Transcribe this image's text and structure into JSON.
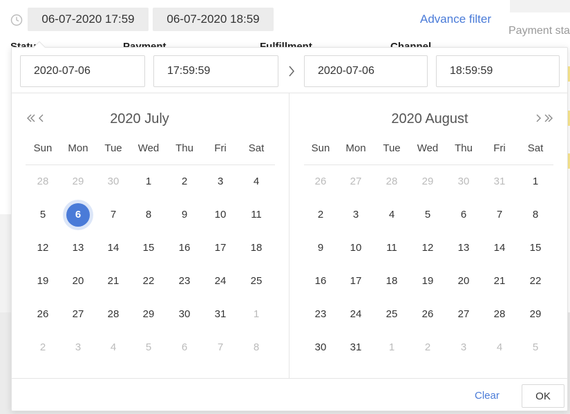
{
  "filter_bar": {
    "icon": "clock-icon",
    "start_chip": "06-07-2020 17:59",
    "end_chip": "06-07-2020 18:59",
    "advance_filter": "Advance filter",
    "payment_status_partial": "Payment sta",
    "labels": [
      "Status",
      "Payment",
      "Fulfillment",
      "Channel"
    ]
  },
  "picker": {
    "start_date": "2020-07-06",
    "start_time": "17:59:59",
    "end_date": "2020-07-06",
    "end_time": "18:59:59",
    "separator_icon": "chevron-right-icon",
    "weekdays": [
      "Sun",
      "Mon",
      "Tue",
      "Wed",
      "Thu",
      "Fri",
      "Sat"
    ],
    "left_month": {
      "title": "2020 July",
      "nav_icons": [
        "double-chevron-left-icon",
        "chevron-left-icon"
      ],
      "weeks": [
        [
          "28",
          "29",
          "30",
          "1",
          "2",
          "3",
          "4"
        ],
        [
          "5",
          "6",
          "7",
          "8",
          "9",
          "10",
          "11"
        ],
        [
          "12",
          "13",
          "14",
          "15",
          "16",
          "17",
          "18"
        ],
        [
          "19",
          "20",
          "21",
          "22",
          "23",
          "24",
          "25"
        ],
        [
          "26",
          "27",
          "28",
          "29",
          "30",
          "31",
          "1"
        ],
        [
          "2",
          "3",
          "4",
          "5",
          "6",
          "7",
          "8"
        ]
      ],
      "muted_prefix": 3,
      "muted_suffix": 8,
      "selected_day": "6"
    },
    "right_month": {
      "title": "2020 August",
      "nav_icons": [
        "chevron-right-icon",
        "double-chevron-right-icon"
      ],
      "weeks": [
        [
          "26",
          "27",
          "28",
          "29",
          "30",
          "31",
          "1"
        ],
        [
          "2",
          "3",
          "4",
          "5",
          "6",
          "7",
          "8"
        ],
        [
          "9",
          "10",
          "11",
          "12",
          "13",
          "14",
          "15"
        ],
        [
          "16",
          "17",
          "18",
          "19",
          "20",
          "21",
          "22"
        ],
        [
          "23",
          "24",
          "25",
          "26",
          "27",
          "28",
          "29"
        ],
        [
          "30",
          "31",
          "1",
          "2",
          "3",
          "4",
          "5"
        ]
      ],
      "muted_prefix": 6,
      "muted_suffix": 5,
      "selected_day": null
    },
    "footer": {
      "clear": "Clear",
      "ok": "OK"
    }
  },
  "colors": {
    "accent": "#4a7bd8",
    "muted_day": "#bbbbbb",
    "selected_halo": "#dce6f8"
  }
}
